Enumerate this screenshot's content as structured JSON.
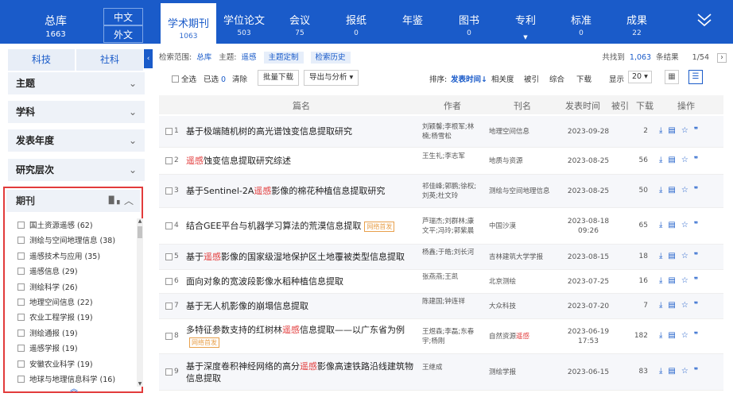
{
  "header": {
    "total_label": "总库",
    "total_count": "1663",
    "lang_zh": "中文",
    "lang_en": "外文",
    "tabs": [
      {
        "label": "学术期刊",
        "count": "1063"
      },
      {
        "label": "学位论文",
        "count": "503"
      },
      {
        "label": "会议",
        "count": "75"
      },
      {
        "label": "报纸",
        "count": "0"
      },
      {
        "label": "年鉴",
        "count": ""
      },
      {
        "label": "图书",
        "count": "0"
      },
      {
        "label": "专利",
        "count": ""
      },
      {
        "label": "标准",
        "count": "0"
      },
      {
        "label": "成果",
        "count": "22"
      }
    ],
    "expand_icon": "double-chevron-down-icon"
  },
  "sidebar": {
    "tabs": [
      "科技",
      "社科"
    ],
    "collapse_icon": "‹",
    "facets": [
      "主题",
      "学科",
      "发表年度",
      "研究层次"
    ],
    "journal_facet": {
      "label": "期刊",
      "items": [
        "国土资源遥感 (62)",
        "测绘与空间地理信息 (38)",
        "遥感技术与应用 (35)",
        "遥感信息 (29)",
        "测绘科学 (26)",
        "地理空间信息 (22)",
        "农业工程学报 (19)",
        "测绘通报 (19)",
        "遥感学报 (19)",
        "安徽农业科学 (19)",
        "地球与地理信息科学 (16)"
      ]
    }
  },
  "scope": {
    "label": "检索范围:",
    "value": "总库",
    "topic_label": "主题:",
    "topic_value": "遥感",
    "custom_btn": "主题定制",
    "history_btn": "检索历史",
    "found_prefix": "共找到",
    "found_count": "1,063",
    "found_suffix": "条结果",
    "page": "1/54",
    "next": "›"
  },
  "toolbar": {
    "select_all": "全选",
    "selected_label": "已选",
    "selected_count": "0",
    "clear": "清除",
    "batch_download": "批量下载",
    "export": "导出与分析",
    "sort_label": "排序:",
    "sort_options": [
      "发表时间",
      "相关度",
      "被引",
      "综合",
      "下载"
    ],
    "sort_arrow": "↓",
    "show_label": "显示",
    "page_size": "20"
  },
  "table": {
    "headers": [
      "篇名",
      "作者",
      "刊名",
      "发表时间",
      "被引",
      "下载",
      "操作"
    ],
    "rows": [
      {
        "idx": "1",
        "title_pre": "基于极端随机树的高光谱蚀变信息提取研究",
        "hl": "",
        "title_post": "",
        "badge": "",
        "author": "刘颖馨;李根军;林楠;杨雪松",
        "journal_pre": "地理空间信息",
        "journal_hl": "",
        "date": "2023-09-28",
        "time": "",
        "cite": "",
        "download": "2"
      },
      {
        "idx": "2",
        "title_pre": "",
        "hl": "遥感",
        "title_post": "蚀变信息提取研究综述",
        "badge": "",
        "author": "王生礼;李志军",
        "journal_pre": "地质与资源",
        "journal_hl": "",
        "date": "2023-08-25",
        "time": "",
        "cite": "",
        "download": "56"
      },
      {
        "idx": "3",
        "title_pre": "基于Sentinel-2A",
        "hl": "遥感",
        "title_post": "影像的棉花种植信息提取研究",
        "badge": "",
        "author": "祁佳峰;郭鹏;徐权;刘英;杜文玲",
        "journal_pre": "测绘与空间地理信息",
        "journal_hl": "",
        "date": "2023-08-25",
        "time": "",
        "cite": "",
        "download": "50"
      },
      {
        "idx": "4",
        "title_pre": "结合GEE平台与机器学习算法的荒漠信息提取",
        "hl": "",
        "title_post": "",
        "badge": "网络首发",
        "author": "芦瑞杰;刘群林;康文平;冯玲;郭紫晨",
        "journal_pre": "中国沙漠",
        "journal_hl": "",
        "date": "2023-08-18",
        "time": "09:26",
        "cite": "",
        "download": "65"
      },
      {
        "idx": "5",
        "title_pre": "基于",
        "hl": "遥感",
        "title_post": "影像的国家级湿地保护区土地覆被类型信息提取",
        "badge": "",
        "author": "杨鑫;于皓;刘长河",
        "journal_pre": "吉林建筑大学学报",
        "journal_hl": "",
        "date": "2023-08-15",
        "time": "",
        "cite": "",
        "download": "18"
      },
      {
        "idx": "6",
        "title_pre": "面向对象的宽波段影像水稻种植信息提取",
        "hl": "",
        "title_post": "",
        "badge": "",
        "author": "张燕燕;王凯",
        "journal_pre": "北京测绘",
        "journal_hl": "",
        "date": "2023-07-25",
        "time": "",
        "cite": "",
        "download": "16"
      },
      {
        "idx": "7",
        "title_pre": "基于无人机影像的崩塌信息提取",
        "hl": "",
        "title_post": "",
        "badge": "",
        "author": "陈建国;钟连祥",
        "journal_pre": "大众科技",
        "journal_hl": "",
        "date": "2023-07-20",
        "time": "",
        "cite": "",
        "download": "7"
      },
      {
        "idx": "8",
        "title_pre": "多特征参数支持的红树林",
        "hl": "遥感",
        "title_post": "信息提取——以广东省为例",
        "badge": "网络首发",
        "author": "王煜森;李磊;东春宇;杨刚",
        "journal_pre": "自然资源",
        "journal_hl": "遥感",
        "date": "2023-06-19",
        "time": "17:53",
        "cite": "",
        "download": "182"
      },
      {
        "idx": "9",
        "title_pre": "基于深度卷积神经网络的高分",
        "hl": "遥感",
        "title_post": "影像高速铁路沿线建筑物信息提取",
        "badge": "",
        "author": "王继成",
        "journal_pre": "测绘学报",
        "journal_hl": "",
        "date": "2023-06-15",
        "time": "",
        "cite": "",
        "download": "83"
      }
    ]
  },
  "colors": {
    "brand": "#1a5bc9",
    "highlight": "#e23b3b",
    "badge": "#e8a04b"
  }
}
